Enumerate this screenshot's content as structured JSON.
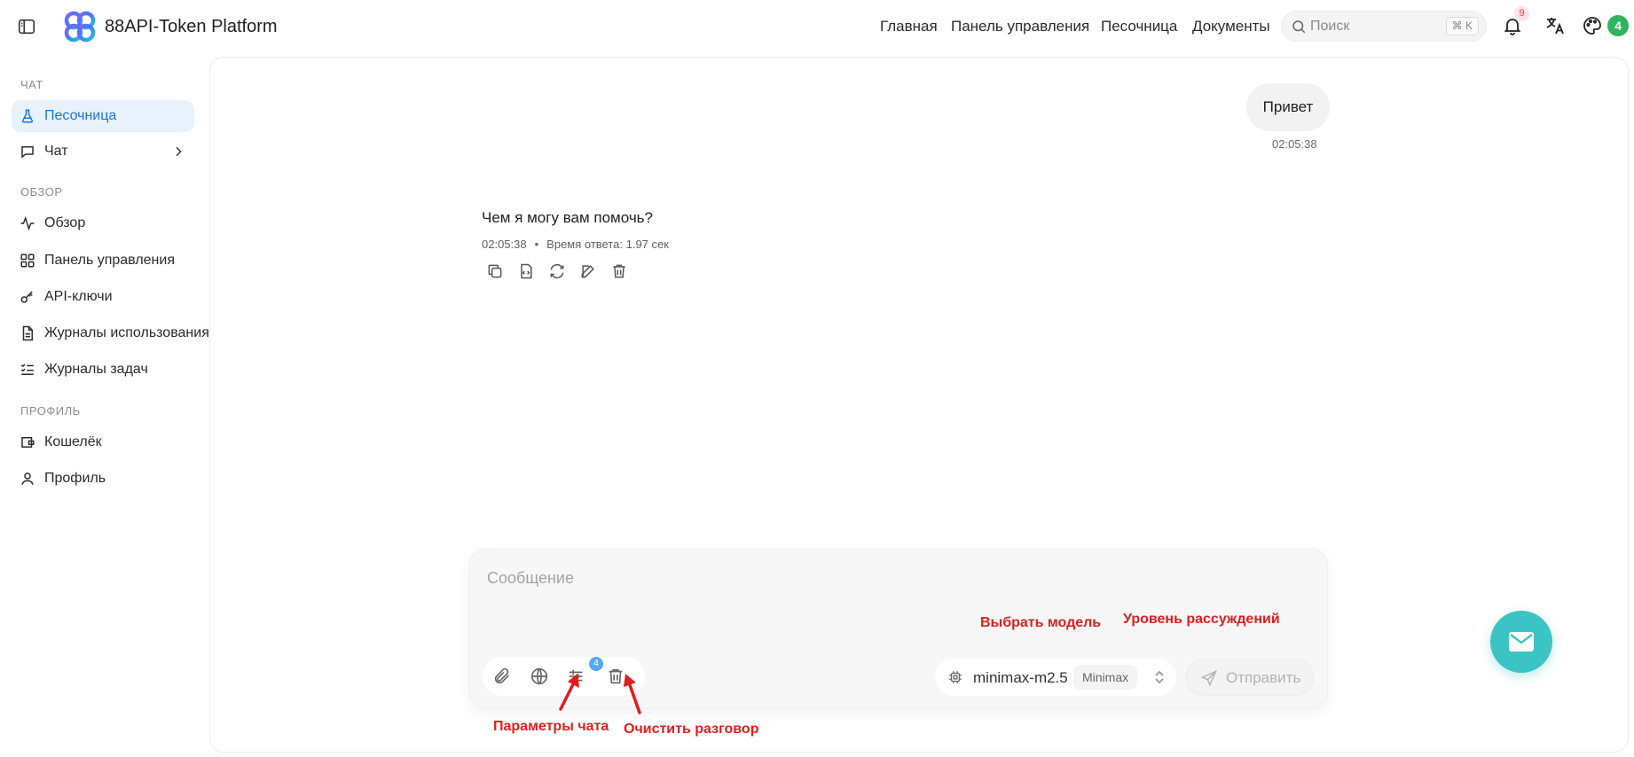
{
  "header": {
    "app_title": "88API-Token Platform",
    "nav": [
      "Главная",
      "Панель управления",
      "Песочница",
      "Документы"
    ],
    "search": {
      "placeholder": "Поиск",
      "shortcut": "⌘ K"
    },
    "notifications_count": "9",
    "theme_badge": "4",
    "icons": [
      "sidebar-toggle-icon",
      "logo",
      "search-icon",
      "bell-icon",
      "translate-icon",
      "palette-icon"
    ]
  },
  "sidebar": {
    "sections": [
      {
        "title": "ЧАТ",
        "items": [
          {
            "label": "Песочница",
            "icon": "flask-icon",
            "active": true
          },
          {
            "label": "Чат",
            "icon": "chat-icon",
            "has_submenu": true
          }
        ]
      },
      {
        "title": "ОБЗОР",
        "items": [
          {
            "label": "Обзор",
            "icon": "activity-icon"
          },
          {
            "label": "Панель управления",
            "icon": "grid-icon"
          },
          {
            "label": "API-ключи",
            "icon": "key-icon"
          },
          {
            "label": "Журналы использования",
            "icon": "document-icon"
          },
          {
            "label": "Журналы задач",
            "icon": "checklist-icon"
          }
        ]
      },
      {
        "title": "ПРОФИЛЬ",
        "items": [
          {
            "label": "Кошелёк",
            "icon": "wallet-icon"
          },
          {
            "label": "Профиль",
            "icon": "user-icon"
          }
        ]
      }
    ]
  },
  "chat": {
    "user_message": {
      "text": "Привет",
      "time": "02:05:38"
    },
    "assistant_message": {
      "text": "Чем я могу вам помочь?",
      "time": "02:05:38",
      "separator": "•",
      "response_time": "Время ответа: 1.97 сек",
      "actions": [
        "copy-icon",
        "copy-code-icon",
        "regenerate-icon",
        "edit-icon",
        "delete-icon"
      ]
    }
  },
  "composer": {
    "placeholder": "Сообщение",
    "tools": [
      "paperclip-icon",
      "globe-icon",
      "sliders-icon",
      "trash-icon"
    ],
    "params_badge": "4",
    "model": "minimax-m2.5",
    "provider": "Minimax",
    "send_label": "Отправить"
  },
  "annotations": {
    "select_model": "Выбрать модель",
    "reasoning_level": "Уровень рассуждений",
    "chat_params": "Параметры чата",
    "clear_chat": "Очистить разговор"
  },
  "colors": {
    "accent": "#1a73e8",
    "active_bg": "#e8f2fd",
    "annotation": "#e01e1e",
    "fab": "#3cc4c4",
    "badge_green": "#2fb55d"
  }
}
